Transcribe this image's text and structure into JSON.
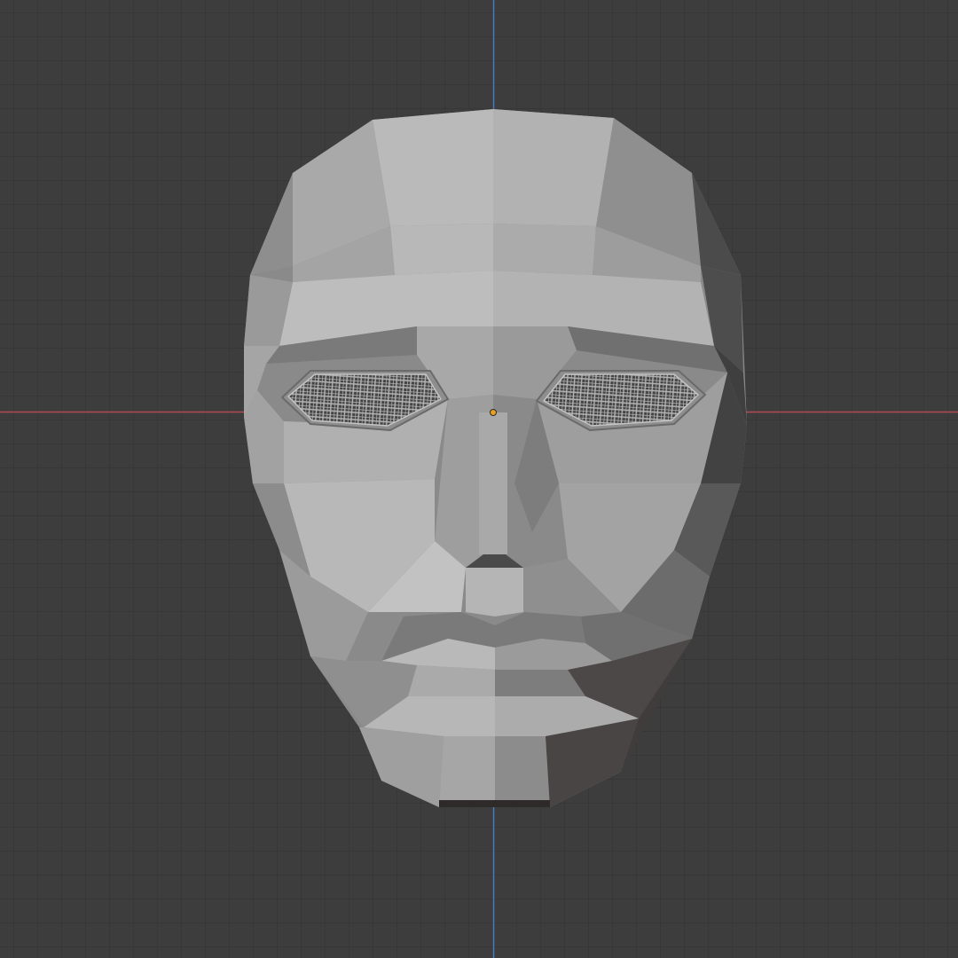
{
  "viewport": {
    "background": "#3d3d3d",
    "grid_minor_color": "#333333",
    "grid_major_color": "#2e2e2e",
    "x_axis_color": "#b34a55",
    "y_axis_color": "#4a7bc4",
    "origin_color": "#e8a21a"
  },
  "object": {
    "icon": "face-mask-mesh-icon",
    "shading": "solid",
    "eye_mesh_pattern": "wire-grid"
  }
}
